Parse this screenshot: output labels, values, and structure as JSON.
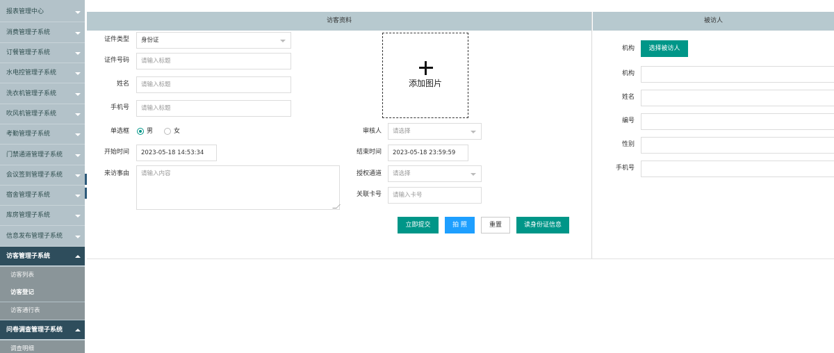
{
  "sidebar": {
    "items": [
      {
        "label": "报表管理中心"
      },
      {
        "label": "消费管理子系统"
      },
      {
        "label": "订餐管理子系统"
      },
      {
        "label": "水电控管理子系统"
      },
      {
        "label": "洗衣机管理子系统"
      },
      {
        "label": "吹风机管理子系统"
      },
      {
        "label": "考勤管理子系统"
      },
      {
        "label": "门禁通道管理子系统"
      },
      {
        "label": "会议签到管理子系统"
      },
      {
        "label": "宿舍管理子系统"
      },
      {
        "label": "库房管理子系统"
      },
      {
        "label": "信息发布管理子系统"
      }
    ],
    "visitor_group": {
      "label": "访客管理子系统",
      "subs": [
        {
          "label": "访客列表"
        },
        {
          "label": "访客登记"
        },
        {
          "label": "访客通行表"
        }
      ]
    },
    "survey_group": {
      "label": "问卷调查管理子系统",
      "subs": [
        {
          "label": "调查明细"
        }
      ]
    }
  },
  "visitor_panel": {
    "title": "访客资料",
    "id_type": {
      "label": "证件类型",
      "value": "身份证"
    },
    "id_number": {
      "label": "证件号码",
      "placeholder": "请输入标题"
    },
    "name": {
      "label": "姓名",
      "placeholder": "请输入标题"
    },
    "phone": {
      "label": "手机号",
      "placeholder": "请输入标题"
    },
    "gender": {
      "label": "单选框",
      "options": [
        "男",
        "女"
      ],
      "selected": "男"
    },
    "start_time": {
      "label": "开始时间",
      "value": "2023-05-18 14:53:34"
    },
    "reason": {
      "label": "来访事由",
      "placeholder": "请输入内容"
    },
    "upload": {
      "label": "添加图片"
    },
    "reviewer": {
      "label": "审核人",
      "placeholder": "请选择"
    },
    "end_time": {
      "label": "结束时间",
      "value": "2023-05-18 23:59:59"
    },
    "channel": {
      "label": "授权通道",
      "placeholder": "请选择"
    },
    "card": {
      "label": "关联卡号",
      "placeholder": "请输入卡号"
    },
    "buttons": {
      "submit": "立即提交",
      "photo": "拍 照",
      "reset": "重置",
      "read_id": "读身份证信息"
    }
  },
  "host_panel": {
    "title": "被访人",
    "org_select": {
      "label": "机构",
      "button": "选择被访人"
    },
    "fields": [
      {
        "label": "机构"
      },
      {
        "label": "姓名"
      },
      {
        "label": "编号"
      },
      {
        "label": "性别"
      },
      {
        "label": "手机号"
      }
    ]
  },
  "colors": {
    "accent": "#009688",
    "photo_button": "#1e9fff",
    "sidebar_bg": "#b3c2c9",
    "sidebar_active": "#2e4d5c",
    "header_bg": "#b7c9cf"
  }
}
